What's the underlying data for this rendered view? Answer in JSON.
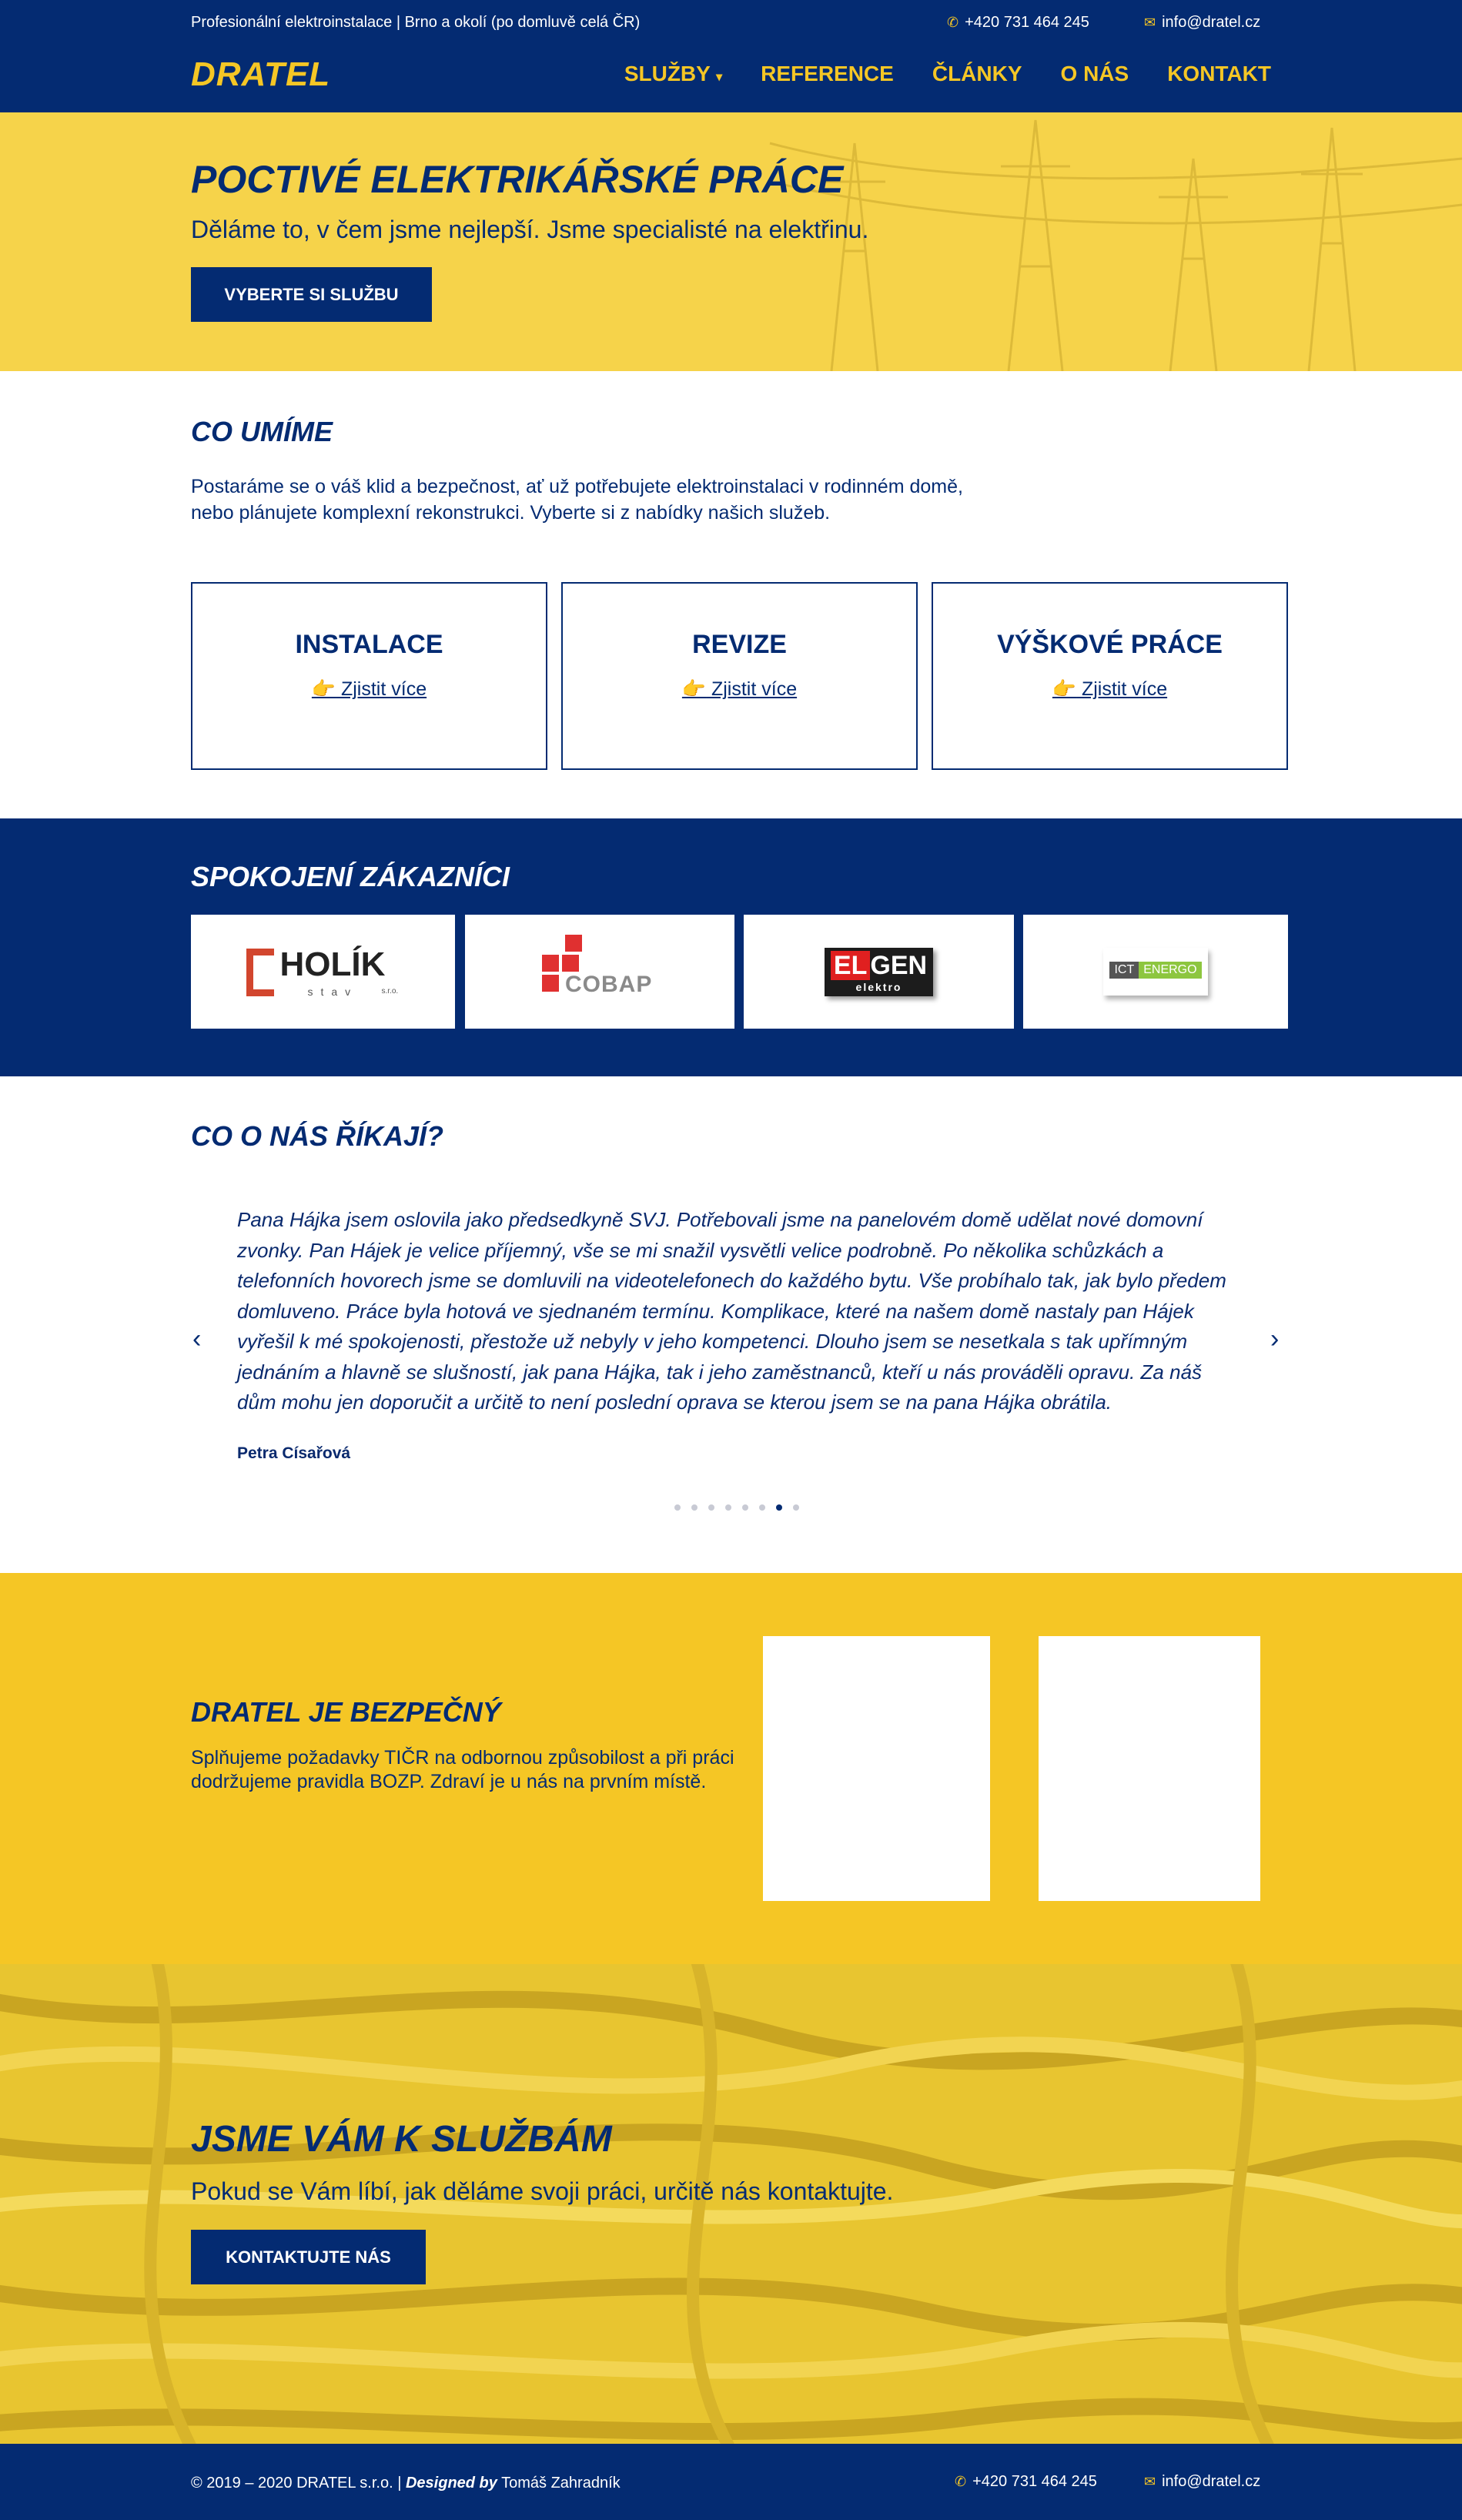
{
  "topbar": {
    "tagline": "Profesionální elektroinstalace | Brno a okolí (po domluvě celá ČR)",
    "phone": "+420 731 464 245",
    "email": "info@dratel.cz"
  },
  "header": {
    "logo": "DRATEL",
    "nav": [
      "SLUŽBY",
      "REFERENCE",
      "ČLÁNKY",
      "O NÁS",
      "KONTAKT"
    ]
  },
  "hero": {
    "title": "POCTIVÉ ELEKTRIKÁŘSKÉ PRÁCE",
    "subtitle": "Děláme to, v čem jsme nejlepší. Jsme specialisté na elektřinu.",
    "button": "VYBERTE SI SLUŽBU"
  },
  "services": {
    "title": "CO UMÍME",
    "text1": "Postaráme se o váš klid a bezpečnost, ať už potřebujete elektroinstalaci v rodinném domě,",
    "text2": "nebo plánujete komplexní rekonstrukci. Vyberte si z nabídky našich služeb.",
    "cards": [
      {
        "title": "INSTALACE",
        "link": "Zjistit více"
      },
      {
        "title": "REVIZE",
        "link": "Zjistit více"
      },
      {
        "title": "VÝŠKOVÉ PRÁCE",
        "link": "Zjistit více"
      }
    ]
  },
  "customers": {
    "title": "SPOKOJENÍ ZÁKAZNÍCI",
    "logos": [
      "HOLÍK",
      "stav",
      "s.r.o.",
      "COBAP",
      "EL",
      "GEN",
      "elektro",
      "ICT",
      "ENERGO"
    ]
  },
  "testimonials": {
    "title": "CO O NÁS ŘÍKAJÍ?",
    "quote": "Pana Hájka jsem oslovila jako předsedkyně SVJ. Potřebovali jsme na panelovém domě udělat nové domovní zvonky. Pan Hájek je velice příjemný, vše se mi snažil vysvětli velice podrobně. Po několika schůzkách a telefonních hovorech jsme se domluvili na videotelefonech do každého bytu. Vše probíhalo tak, jak bylo předem domluveno. Práce byla hotová ve sjednaném termínu. Komplikace, které na našem domě nastaly pan Hájek vyřešil k mé spokojenosti, přestože už nebyly v jeho kompetenci. Dlouho jsem se nesetkala s tak upřímným jednáním a hlavně se slušností, jak pana Hájka, tak i jeho zaměstnanců, kteří u nás prováděli opravu. Za náš dům mohu jen doporučit a určitě to není poslední oprava se kterou jsem se na pana Hájka obrátila.",
    "author": "Petra Císařová",
    "prev": "‹",
    "next": "›"
  },
  "safety": {
    "title": "DRATEL JE BEZPEČNÝ",
    "text": "Splňujeme požadavky TIČR na odbornou způsobilost a při práci dodržujeme pravidla BOZP. Zdraví je u nás na prvním místě."
  },
  "contact": {
    "title": "JSME VÁM K SLUŽBÁM",
    "text": "Pokud se Vám líbí, jak děláme svoji práci, určitě nás kontaktujte.",
    "button": "KONTAKTUJTE NÁS"
  },
  "footer": {
    "copyright": "© 2019 – 2020 DRATEL s.r.o. |",
    "designed_by_label": "Designed by",
    "designer": "Tomáš Zahradník",
    "phone": "+420 731 464 245",
    "email": "info@dratel.cz"
  }
}
